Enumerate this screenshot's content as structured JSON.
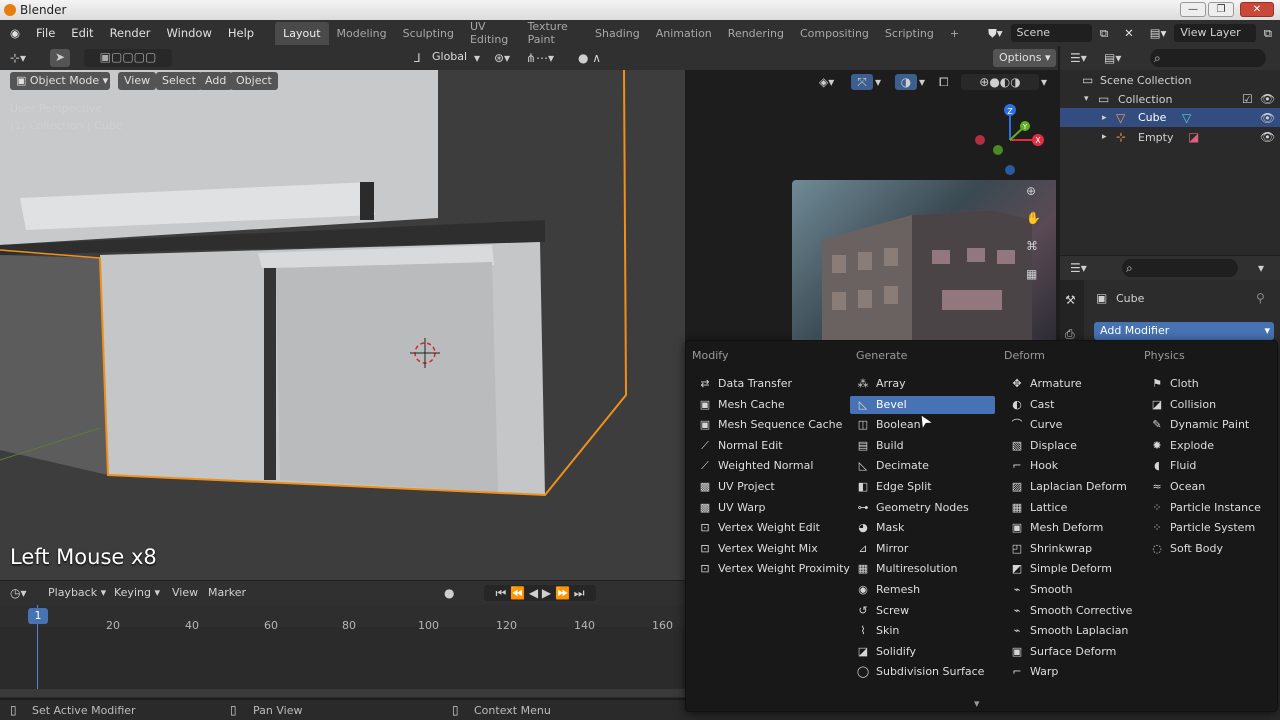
{
  "window": {
    "title": "Blender"
  },
  "menubar": {
    "items": [
      "File",
      "Edit",
      "Render",
      "Window",
      "Help"
    ]
  },
  "workspaces": [
    "Layout",
    "Modeling",
    "Sculpting",
    "UV Editing",
    "Texture Paint",
    "Shading",
    "Animation",
    "Rendering",
    "Compositing",
    "Scripting"
  ],
  "scene": {
    "label": "Scene",
    "view_layer": "View Layer"
  },
  "viewport": {
    "mode": "Object Mode",
    "menus": [
      "View",
      "Select",
      "Add",
      "Object"
    ],
    "transform_orientation": "Global",
    "options_label": "Options",
    "overlay_line1": "User Perspective",
    "overlay_line2": "(1) Collection | Cube",
    "gizmo_axis": {
      "z": "Z",
      "y": "Y",
      "x": "X"
    },
    "operator_caption": "Left Mouse x8"
  },
  "outliner": {
    "items": [
      {
        "label": "Scene Collection"
      },
      {
        "label": "Collection"
      },
      {
        "label": "Cube"
      },
      {
        "label": "Empty"
      }
    ]
  },
  "properties": {
    "object_name": "Cube",
    "add_modifier_label": "Add Modifier"
  },
  "add_modifier_menu": {
    "columns": [
      {
        "header": "Modify",
        "items": [
          {
            "label": "Data Transfer",
            "icon": "⇄"
          },
          {
            "label": "Mesh Cache",
            "icon": "▣"
          },
          {
            "label": "Mesh Sequence Cache",
            "icon": "▣"
          },
          {
            "label": "Normal Edit",
            "icon": "⟋"
          },
          {
            "label": "Weighted Normal",
            "icon": "⟋"
          },
          {
            "label": "UV Project",
            "icon": "▩"
          },
          {
            "label": "UV Warp",
            "icon": "▩"
          },
          {
            "label": "Vertex Weight Edit",
            "icon": "⊡"
          },
          {
            "label": "Vertex Weight Mix",
            "icon": "⊡"
          },
          {
            "label": "Vertex Weight Proximity",
            "icon": "⊡"
          }
        ]
      },
      {
        "header": "Generate",
        "items": [
          {
            "label": "Array",
            "icon": "⁂"
          },
          {
            "label": "Bevel",
            "icon": "◺"
          },
          {
            "label": "Boolean",
            "icon": "◫"
          },
          {
            "label": "Build",
            "icon": "▤"
          },
          {
            "label": "Decimate",
            "icon": "◺"
          },
          {
            "label": "Edge Split",
            "icon": "◧"
          },
          {
            "label": "Geometry Nodes",
            "icon": "⊶"
          },
          {
            "label": "Mask",
            "icon": "◕"
          },
          {
            "label": "Mirror",
            "icon": "⊿"
          },
          {
            "label": "Multiresolution",
            "icon": "▦"
          },
          {
            "label": "Remesh",
            "icon": "◉"
          },
          {
            "label": "Screw",
            "icon": "↺"
          },
          {
            "label": "Skin",
            "icon": "⌇"
          },
          {
            "label": "Solidify",
            "icon": "◪"
          },
          {
            "label": "Subdivision Surface",
            "icon": "◯"
          }
        ]
      },
      {
        "header": "Deform",
        "items": [
          {
            "label": "Armature",
            "icon": "✥"
          },
          {
            "label": "Cast",
            "icon": "◐"
          },
          {
            "label": "Curve",
            "icon": "⌒"
          },
          {
            "label": "Displace",
            "icon": "▧"
          },
          {
            "label": "Hook",
            "icon": "⌐"
          },
          {
            "label": "Laplacian Deform",
            "icon": "▨"
          },
          {
            "label": "Lattice",
            "icon": "▦"
          },
          {
            "label": "Mesh Deform",
            "icon": "▣"
          },
          {
            "label": "Shrinkwrap",
            "icon": "◰"
          },
          {
            "label": "Simple Deform",
            "icon": "◩"
          },
          {
            "label": "Smooth",
            "icon": "⌁"
          },
          {
            "label": "Smooth Corrective",
            "icon": "⌁"
          },
          {
            "label": "Smooth Laplacian",
            "icon": "⌁"
          },
          {
            "label": "Surface Deform",
            "icon": "▣"
          },
          {
            "label": "Warp",
            "icon": "⌐"
          }
        ]
      },
      {
        "header": "Physics",
        "items": [
          {
            "label": "Cloth",
            "icon": "⚑"
          },
          {
            "label": "Collision",
            "icon": "◪"
          },
          {
            "label": "Dynamic Paint",
            "icon": "✎"
          },
          {
            "label": "Explode",
            "icon": "✸"
          },
          {
            "label": "Fluid",
            "icon": "◖"
          },
          {
            "label": "Ocean",
            "icon": "≈"
          },
          {
            "label": "Particle Instance",
            "icon": "⁘"
          },
          {
            "label": "Particle System",
            "icon": "⁘"
          },
          {
            "label": "Soft Body",
            "icon": "◌"
          }
        ]
      }
    ],
    "highlighted": "Bevel"
  },
  "timeline": {
    "menus": [
      "Playback",
      "Keying",
      "View",
      "Marker"
    ],
    "current_frame": "1",
    "ticks": [
      "20",
      "40",
      "60",
      "80",
      "100",
      "120",
      "140",
      "160"
    ]
  },
  "statusbar": {
    "items": [
      "Set Active Modifier",
      "Pan View",
      "Context Menu"
    ]
  },
  "colors": {
    "accent": "#4772b3",
    "selection_orange": "#f0901c",
    "header": "#303030",
    "viewport": "#3d3d3d"
  }
}
